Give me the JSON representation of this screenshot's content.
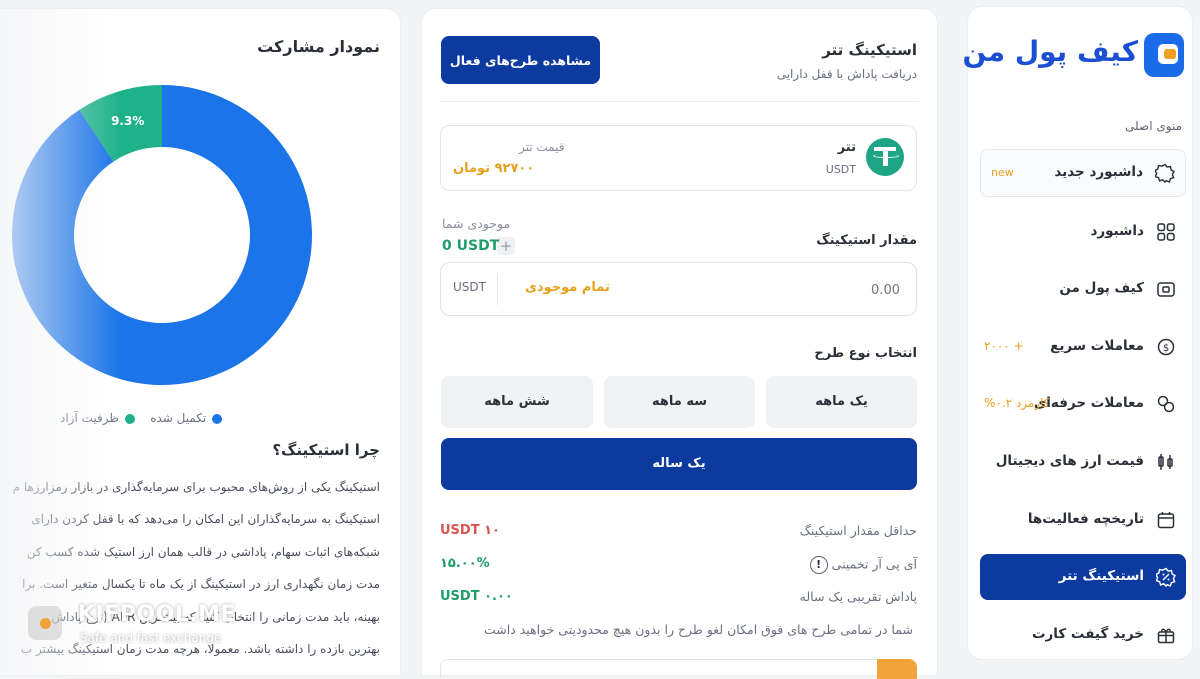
{
  "sidebar": {
    "logo_text": "کیف پول من",
    "menu_title": "منوی اصلی",
    "items": [
      {
        "label": "داشبورد جدید",
        "tag": "new"
      },
      {
        "label": "داشبورد",
        "tag": ""
      },
      {
        "label": "کیف پول من",
        "tag": ""
      },
      {
        "label": "معاملات سریع",
        "tag": "+ ۲۰۰۰"
      },
      {
        "label": "معاملات حرفه‌ای",
        "tag": "کارمزد ۰.۲%"
      },
      {
        "label": "قیمت ارز های دیجیتال",
        "tag": ""
      },
      {
        "label": "تاریخچه فعالیت‌ها",
        "tag": ""
      },
      {
        "label": "استیکینگ تتر",
        "tag": ""
      },
      {
        "label": "خرید گیفت کارت",
        "tag": ""
      }
    ]
  },
  "staking": {
    "title": "استیکینگ تتر",
    "subtitle": "دریافت پاداش با قفل دارایی",
    "view_plans_button": "مشاهده طرح‌های فعال",
    "coin": {
      "name": "تتر",
      "symbol": "USDT",
      "price_label": "قیمت تتر",
      "price_value": "۹۲۷۰۰ تومان"
    },
    "balance_label": "موجودی شما",
    "balance_value": "0 USDT",
    "balance_plus": "+",
    "amount_label": "مقدار استیکینگ",
    "amount_value": "0.00",
    "all_balance": "تمام موجودی",
    "currency": "USDT",
    "plan_label": "انتخاب نوع طرح",
    "plans": [
      "یک ماهه",
      "سه ماهه",
      "شش ماهه",
      "یک ساله"
    ],
    "rows": [
      {
        "key": "حداقل مقدار استیکینگ",
        "value": "۱۰ USDT",
        "color": "#d9534f"
      },
      {
        "key": "آی پی آر تخمینی",
        "value": "۱۵.۰۰%",
        "color": "#1f9d6a"
      },
      {
        "key": "پاداش تقریبی یک ساله",
        "value": "۰.۰۰ USDT",
        "color": "#1f9d6a"
      }
    ],
    "info_icon": "!",
    "note": "شما در تمامی طرح های فوق امکان لغو طرح را بدون هیچ محدودیتی خواهید داشت"
  },
  "chart_panel": {
    "title": "نمودار مشارکت",
    "legend": [
      {
        "label": "تکمیل شده",
        "color": "#1b74e8"
      },
      {
        "label": "ظرفیت آزاد",
        "color": "#1fb28a"
      }
    ],
    "why_title": "چرا استیکینگ؟",
    "why_lines": [
      "استیکینگ یکی از روش‌های محبوب برای سرمایه‌گذاری در بازار رمزارزها م",
      "استیکینگ به سرمایه‌گذاران این امکان را می‌دهد که با قفل کردن دارای",
      "شبکه‌های اثبات سهام، پاداشی در قالب همان ارز استیک شده کسب کن",
      "مدت زمان نگهداری ارز در استیکینگ از یک ماه تا یکسال متغیر است. برا",
      "بهینه، باید مدت زمانی را انتخاب کنید که بیشترین APR (نرخ پاداش",
      "بهترین بازده را داشته باشد. معمولا، هرچه مدت زمان استیکینگ بیشتر ب"
    ]
  },
  "chart_data": {
    "type": "pie",
    "donut": true,
    "categories": [
      "تکمیل شده",
      "ظرفیت آزاد"
    ],
    "values": [
      90.7,
      9.3
    ],
    "labels": [
      "90.7%",
      "9.3%"
    ],
    "colors": [
      "#1b74e8",
      "#1fb28a"
    ],
    "title": "نمودار مشارکت",
    "legend": "bottom"
  },
  "watermark": {
    "brand": "KIFPOOL.ME",
    "tagline": "Safe and fast exchange"
  }
}
